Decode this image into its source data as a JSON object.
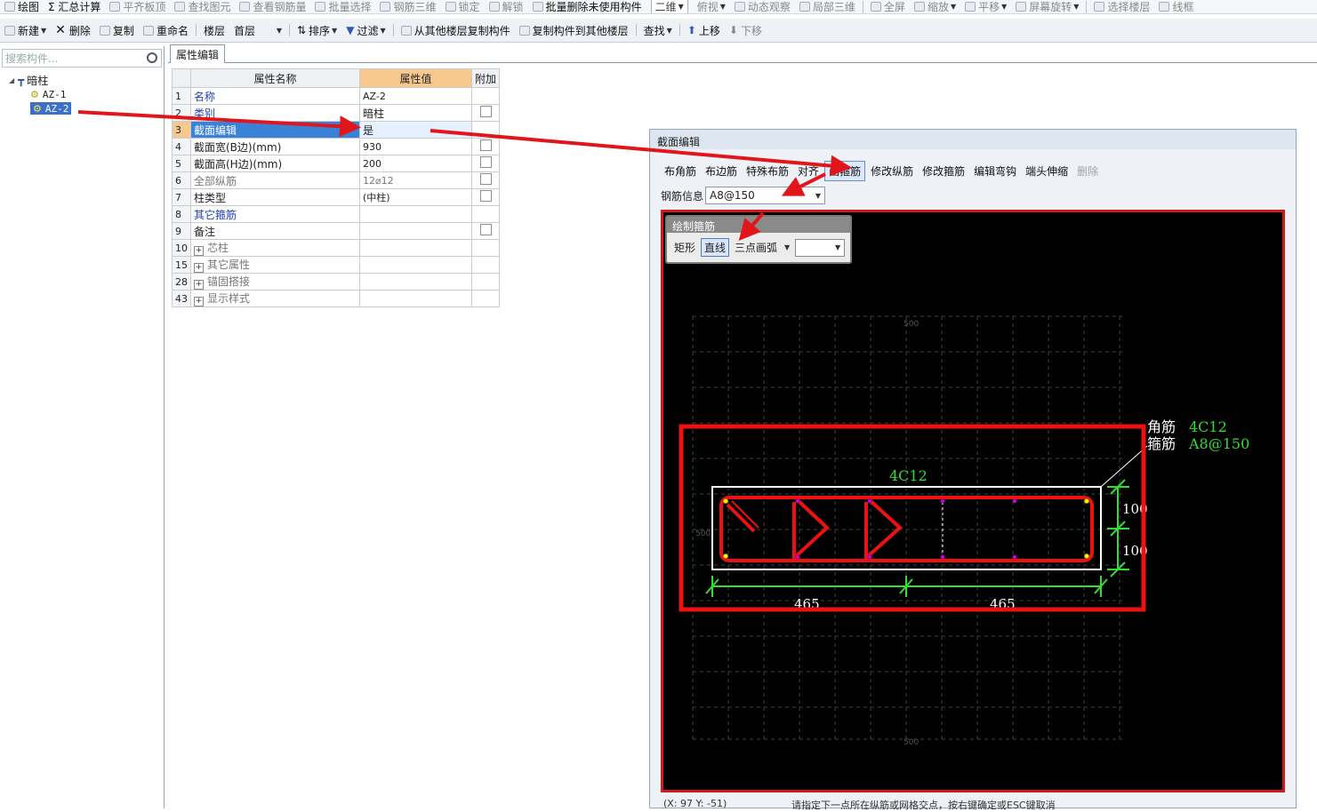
{
  "toolbar1": [
    "绘图",
    "Σ 汇总计算",
    "平齐板顶",
    "查找图元",
    "查看钢筋量",
    "批量选择",
    "钢筋三维",
    "锁定",
    "解锁",
    "批量删除未使用构件",
    "二维",
    "俯视",
    "动态观察",
    "局部三维",
    "全屏",
    "缩放",
    "平移",
    "屏幕旋转",
    "选择楼层",
    "线框"
  ],
  "toolbar2": {
    "new": "新建",
    "delete": "删除",
    "copy": "复制",
    "rename": "重命名",
    "floor_label": "楼层",
    "floor_value": "首层",
    "sort": "排序",
    "filter": "过滤",
    "copy_from": "从其他楼层复制构件",
    "copy_to": "复制构件到其他楼层",
    "find": "查找",
    "up": "上移",
    "down": "下移"
  },
  "search_placeholder": "搜索构件...",
  "tree": {
    "root": "暗柱",
    "items": [
      "AZ-1",
      "AZ-2"
    ]
  },
  "tab": "属性编辑",
  "prop_headers": [
    "属性名称",
    "属性值",
    "附加"
  ],
  "props": [
    {
      "n": "1",
      "name": "名称",
      "val": "AZ-2"
    },
    {
      "n": "2",
      "name": "类别",
      "val": "暗柱"
    },
    {
      "n": "3",
      "name": "截面编辑",
      "val": "是"
    },
    {
      "n": "4",
      "name": "截面宽(B边)(mm)",
      "val": "930"
    },
    {
      "n": "5",
      "name": "截面高(H边)(mm)",
      "val": "200"
    },
    {
      "n": "6",
      "name": "全部纵筋",
      "val": "12⌀12"
    },
    {
      "n": "7",
      "name": "柱类型",
      "val": "(中柱)"
    },
    {
      "n": "8",
      "name": "其它箍筋",
      "val": ""
    },
    {
      "n": "9",
      "name": "备注",
      "val": ""
    },
    {
      "n": "10",
      "name": "芯柱",
      "val": ""
    },
    {
      "n": "15",
      "name": "其它属性",
      "val": ""
    },
    {
      "n": "28",
      "name": "锚固搭接",
      "val": ""
    },
    {
      "n": "43",
      "name": "显示样式",
      "val": ""
    }
  ],
  "dialog": {
    "title": "截面编辑",
    "buttons": [
      "布角筋",
      "布边筋",
      "特殊布筋",
      "对齐",
      "画箍筋",
      "修改纵筋",
      "修改箍筋",
      "编辑弯钩",
      "端头伸缩",
      "删除"
    ],
    "steel_label": "钢筋信息",
    "steel_value": "A8@150",
    "draw_title": "绘制箍筋",
    "draw_buttons": [
      "矩形",
      "直线",
      "三点画弧"
    ],
    "canvas": {
      "top_rebar": "4C12",
      "callout_corner_label": "角筋",
      "callout_corner_value": "4C12",
      "callout_stirrup_label": "箍筋",
      "callout_stirrup_value": "A8@150",
      "dim_width_left": "465",
      "dim_width_right": "465",
      "dim_height_top": "100",
      "dim_height_bottom": "100",
      "grid_label_top": "500",
      "grid_label_bottom": "500",
      "grid_label_left": "500"
    }
  },
  "status": {
    "coords": "(X: 97 Y: -51)",
    "hint": "请指定下一点所在纵筋或网格交点，按右键确定或ESC键取消"
  }
}
